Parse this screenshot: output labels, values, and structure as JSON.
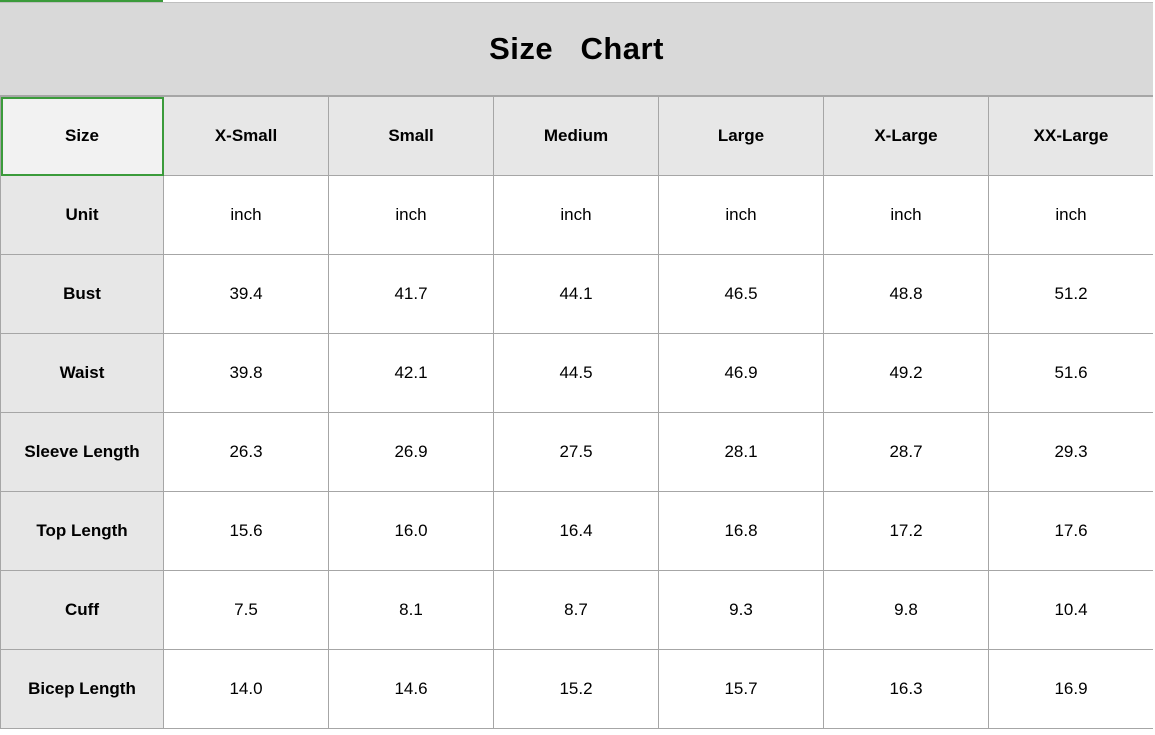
{
  "title": "Size   Chart",
  "corner_label": "Size",
  "columns": [
    "X-Small",
    "Small",
    "Medium",
    "Large",
    "X-Large",
    "XX-Large"
  ],
  "rows": [
    {
      "label": "Unit",
      "values": [
        "inch",
        "inch",
        "inch",
        "inch",
        "inch",
        "inch"
      ]
    },
    {
      "label": "Bust",
      "values": [
        "39.4",
        "41.7",
        "44.1",
        "46.5",
        "48.8",
        "51.2"
      ]
    },
    {
      "label": "Waist",
      "values": [
        "39.8",
        "42.1",
        "44.5",
        "46.9",
        "49.2",
        "51.6"
      ]
    },
    {
      "label": "Sleeve Length",
      "values": [
        "26.3",
        "26.9",
        "27.5",
        "28.1",
        "28.7",
        "29.3"
      ]
    },
    {
      "label": "Top Length",
      "values": [
        "15.6",
        "16.0",
        "16.4",
        "16.8",
        "17.2",
        "17.6"
      ]
    },
    {
      "label": "Cuff",
      "values": [
        "7.5",
        "8.1",
        "8.7",
        "9.3",
        "9.8",
        "10.4"
      ]
    },
    {
      "label": "Bicep Length",
      "values": [
        "14.0",
        "14.6",
        "15.2",
        "15.7",
        "16.3",
        "16.9"
      ]
    }
  ],
  "colors": {
    "title_background": "#d9d9d9",
    "header_background": "#e7e7e7",
    "selected_cell_border": "#3b9b3b",
    "grid_line": "#a6a6a6"
  }
}
